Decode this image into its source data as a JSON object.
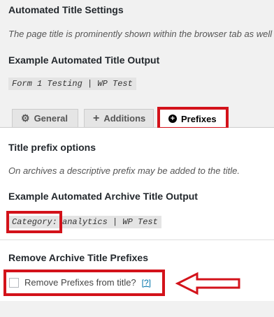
{
  "settings_title": "Automated Title Settings",
  "settings_desc": "The page title is prominently shown within the browser tab as well",
  "example_title_heading": "Example Automated Title Output",
  "example_title_value": "Form 1 Testing | WP Test",
  "tabs": [
    {
      "label": "General",
      "icon": "gear-icon"
    },
    {
      "label": "Additions",
      "icon": "plus-icon"
    },
    {
      "label": "Prefixes",
      "icon": "plus-circle-icon"
    }
  ],
  "prefix_options_heading": "Title prefix options",
  "prefix_desc": "On archives a descriptive prefix may be added to the title.",
  "archive_heading": "Example Automated Archive Title Output",
  "archive_prefix": "Category:",
  "archive_rest": " analytics | WP Test",
  "remove_heading": "Remove Archive Title Prefixes",
  "remove_checkbox_label": "Remove Prefixes from title?",
  "help_link": "[?]",
  "colors": {
    "highlight": "#d3121a",
    "link": "#0073aa"
  }
}
